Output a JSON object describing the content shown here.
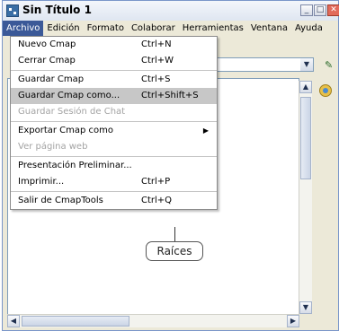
{
  "window": {
    "title": "Sin Título 1"
  },
  "menubar": {
    "items": [
      "Archivo",
      "Edición",
      "Formato",
      "Colaborar",
      "Herramientas",
      "Ventana",
      "Ayuda"
    ]
  },
  "file_menu": {
    "items": [
      {
        "label": "Nuevo Cmap",
        "shortcut": "Ctrl+N",
        "enabled": true
      },
      {
        "label": "Cerrar Cmap",
        "shortcut": "Ctrl+W",
        "enabled": true
      },
      {
        "separator": true
      },
      {
        "label": "Guardar Cmap",
        "shortcut": "Ctrl+S",
        "enabled": true
      },
      {
        "label": "Guardar Cmap como...",
        "shortcut": "Ctrl+Shift+S",
        "enabled": true,
        "highlighted": true
      },
      {
        "label": "Guardar Sesión de Chat",
        "shortcut": "",
        "enabled": false
      },
      {
        "separator": true
      },
      {
        "label": "Exportar Cmap como",
        "shortcut": "",
        "enabled": true,
        "submenu": true
      },
      {
        "label": "Ver página web",
        "shortcut": "",
        "enabled": false
      },
      {
        "separator": true
      },
      {
        "label": "Presentación Preliminar...",
        "shortcut": "",
        "enabled": true
      },
      {
        "label": "Imprimir...",
        "shortcut": "Ctrl+P",
        "enabled": true
      },
      {
        "separator": true
      },
      {
        "label": "Salir de CmapTools",
        "shortcut": "Ctrl+Q",
        "enabled": true
      }
    ]
  },
  "canvas": {
    "concept_label": "Raíces"
  },
  "icons": {
    "app": "cmaptools-app-icon",
    "minimize": "minimize-icon",
    "maximize": "maximize-icon",
    "close": "close-icon",
    "combo_dropdown": "chevron-down-icon",
    "toolbar": "format-styles-icon",
    "palette": "palette-icon",
    "submenu": "submenu-arrow-icon"
  },
  "colors": {
    "menu_active_bg": "#3b5998",
    "menu_highlight_bg": "#c7c7c7",
    "disabled_text": "#a3a3a3"
  }
}
